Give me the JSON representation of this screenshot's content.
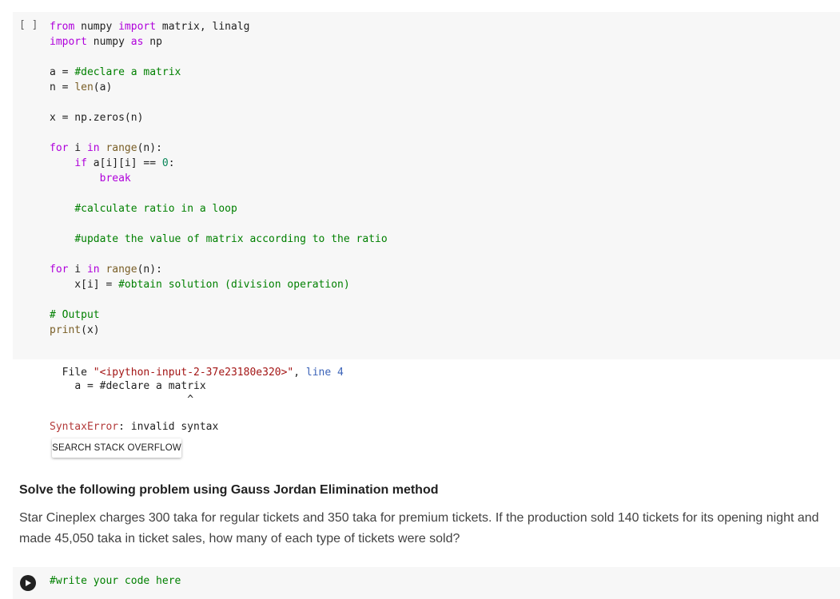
{
  "cell1": {
    "run_indicator": "[ ]",
    "code_lines": [
      [
        {
          "t": "from",
          "c": "purple"
        },
        {
          "t": " numpy ",
          "c": ""
        },
        {
          "t": "import",
          "c": "purple"
        },
        {
          "t": " matrix, linalg",
          "c": ""
        }
      ],
      [
        {
          "t": "import",
          "c": "purple"
        },
        {
          "t": " numpy ",
          "c": ""
        },
        {
          "t": "as",
          "c": "purple"
        },
        {
          "t": " np",
          "c": ""
        }
      ],
      [],
      [
        {
          "t": "a = ",
          "c": ""
        },
        {
          "t": "#declare a matrix",
          "c": "cm"
        }
      ],
      [
        {
          "t": "n = ",
          "c": ""
        },
        {
          "t": "len",
          "c": "bi"
        },
        {
          "t": "(a)",
          "c": ""
        }
      ],
      [],
      [
        {
          "t": "x = np.zeros(n)",
          "c": ""
        }
      ],
      [],
      [
        {
          "t": "for",
          "c": "purple"
        },
        {
          "t": " i ",
          "c": ""
        },
        {
          "t": "in",
          "c": "purple"
        },
        {
          "t": " ",
          "c": ""
        },
        {
          "t": "range",
          "c": "bi"
        },
        {
          "t": "(n):",
          "c": ""
        }
      ],
      [
        {
          "t": "    ",
          "c": ""
        },
        {
          "t": "if",
          "c": "purple"
        },
        {
          "t": " a[i][i] == ",
          "c": ""
        },
        {
          "t": "0",
          "c": "nm"
        },
        {
          "t": ":",
          "c": ""
        }
      ],
      [
        {
          "t": "        ",
          "c": ""
        },
        {
          "t": "break",
          "c": "purple"
        }
      ],
      [],
      [
        {
          "t": "    ",
          "c": ""
        },
        {
          "t": "#calculate ratio in a loop",
          "c": "cm"
        }
      ],
      [],
      [
        {
          "t": "    ",
          "c": ""
        },
        {
          "t": "#update the value of matrix according to the ratio",
          "c": "cm"
        }
      ],
      [],
      [
        {
          "t": "for",
          "c": "purple"
        },
        {
          "t": " i ",
          "c": ""
        },
        {
          "t": "in",
          "c": "purple"
        },
        {
          "t": " ",
          "c": ""
        },
        {
          "t": "range",
          "c": "bi"
        },
        {
          "t": "(n):",
          "c": ""
        }
      ],
      [
        {
          "t": "    x[i] = ",
          "c": ""
        },
        {
          "t": "#obtain solution (division operation)",
          "c": "cm"
        }
      ],
      [],
      [
        {
          "t": "# Output",
          "c": "cm"
        }
      ],
      [
        {
          "t": "print",
          "c": "bi"
        },
        {
          "t": "(x)",
          "c": ""
        }
      ]
    ]
  },
  "output": {
    "file_label": "File",
    "file_path": "\"<ipython-input-2-37e23180e320>\"",
    "line_label": "line",
    "line_number": "4",
    "code_echo": "a = #declare a matrix",
    "caret": "^",
    "error_name": "SyntaxError",
    "error_message": ": invalid syntax",
    "search_button": "SEARCH STACK OVERFLOW"
  },
  "text_cell": {
    "heading": "Solve the following problem using Gauss Jordan Elimination method",
    "paragraph": "Star Cineplex charges 300 taka for regular tickets and 350 taka for premium tickets. If the production sold 140 tickets for its opening night and made 45,050 taka in ticket sales, how many of each type of tickets were sold?"
  },
  "cell2": {
    "code": "#write your code here",
    "run_icon": "play-icon"
  }
}
